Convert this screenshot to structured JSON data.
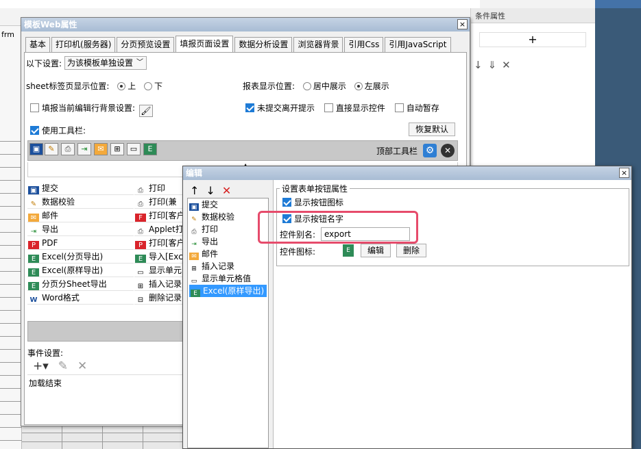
{
  "background": {
    "right_panel_title": "条件属性",
    "left_label": "frm"
  },
  "main_dialog": {
    "title": "模板Web属性",
    "close": "×",
    "tabs": [
      "基本",
      "打印机(服务器)",
      "分页预览设置",
      "填报页面设置",
      "数据分析设置",
      "浏览器背景",
      "引用Css",
      "引用JavaScript"
    ],
    "active_tab": 3,
    "settings_label": "以下设置:",
    "settings_value": "为该模板单独设置",
    "sheet_pos_label": "sheet标签页显示位置:",
    "sheet_pos_options": [
      "上",
      "下"
    ],
    "report_pos_label": "报表显示位置:",
    "report_pos_options": [
      "居中展示",
      "左展示"
    ],
    "fill_bg_label": "填报当前编辑行背景设置:",
    "unsubmit_label": "未提交离开提示",
    "direct_ctrl_label": "直接显示控件",
    "autosave_label": "自动暂存",
    "use_toolbar_label": "使用工具栏:",
    "restore_default": "恢复默认",
    "top_toolbar_label": "顶部工具栏",
    "buttons_col1": [
      "提交",
      "数据校验",
      "邮件",
      "导出",
      "PDF",
      "Excel(分页导出)",
      "Excel(原样导出)",
      "分页分Sheet导出",
      "Word格式"
    ],
    "buttons_col2": [
      "打印",
      "打印(兼",
      "打印[客户",
      "Applet打",
      "打印[客户",
      "导入[Exc",
      "显示单元",
      "插入记录",
      "删除记录"
    ],
    "event_label": "事件设置:",
    "event_items": [
      "加载结束"
    ]
  },
  "edit_dialog": {
    "title": "编辑",
    "close": "×",
    "list": [
      "提交",
      "数据校验",
      "打印",
      "导出",
      "邮件",
      "插入记录",
      "显示单元格值",
      "Excel(原样导出)"
    ],
    "selected_index": 7,
    "legend": "设置表单按钮属性",
    "show_icon_label": "显示按钮图标",
    "show_name_label": "显示按钮名字",
    "alias_label": "控件别名:",
    "alias_value": "export",
    "icon_label": "控件图标:",
    "edit_btn": "编辑",
    "delete_btn": "删除"
  }
}
